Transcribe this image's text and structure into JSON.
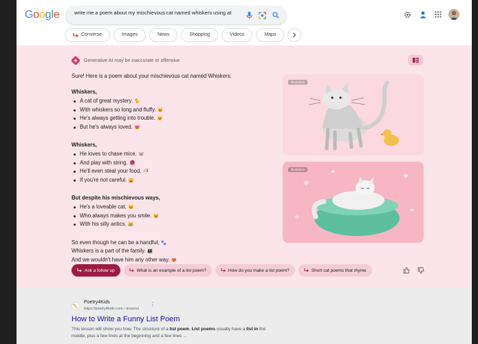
{
  "search": {
    "logo_letters": [
      {
        "char": "G",
        "color": "#4285f4"
      },
      {
        "char": "o",
        "color": "#ea4335"
      },
      {
        "char": "o",
        "color": "#fbbc05"
      },
      {
        "char": "g",
        "color": "#4285f4"
      },
      {
        "char": "l",
        "color": "#34a853"
      },
      {
        "char": "e",
        "color": "#ea4335"
      }
    ],
    "query": "write me a poem about my mischievous cat named whiskers using at least",
    "icons": [
      "mic-icon",
      "lens-icon",
      "search-icon"
    ]
  },
  "header_right": [
    "gear-icon",
    "labs-icon",
    "apps-grid-icon",
    "avatar"
  ],
  "tabs": [
    {
      "label": "Converse",
      "icon": "arrow-icon"
    },
    {
      "label": "Images"
    },
    {
      "label": "News"
    },
    {
      "label": "Shopping"
    },
    {
      "label": "Videos"
    },
    {
      "label": "Maps"
    }
  ],
  "ai": {
    "disclaimer": "Generative AI may be inaccurate or offensive",
    "intro": "Sure! Here is a poem about your mischievous cat named Whiskers:",
    "stanzas": [
      {
        "title": "Whiskers,",
        "lines": [
          {
            "text": "A cat of great mystery.",
            "emoji": "🐈"
          },
          {
            "text": "With whiskers so long and fluffy.",
            "emoji": "🐱"
          },
          {
            "text": "He's always getting into trouble.",
            "emoji": "🐱"
          },
          {
            "text": "But he's always loved.",
            "emoji": "😻"
          }
        ]
      },
      {
        "title": "Whiskers,",
        "lines": [
          {
            "text": "He loves to chase mice.",
            "emoji": "🐭"
          },
          {
            "text": "And play with string.",
            "emoji": "🧶"
          },
          {
            "text": "He'll even steal your food.",
            "emoji": "🍜"
          },
          {
            "text": "If you're not careful.",
            "emoji": "🙀"
          }
        ]
      },
      {
        "title": "But despite his mischievous ways,",
        "lines": [
          {
            "text": "He's a loveable cat.",
            "emoji": "🐱"
          },
          {
            "text": "Who always makes you smile.",
            "emoji": "😺"
          },
          {
            "text": "With his silly antics.",
            "emoji": "😹"
          }
        ]
      }
    ],
    "closing": [
      {
        "text": "So even though he can be a handful,",
        "emoji": "🐾"
      },
      {
        "text": "Whiskers is a part of the family.",
        "emoji": "👨‍👩‍👧"
      },
      {
        "text": "And we wouldn't have him any other way.",
        "emoji": "😻"
      }
    ],
    "image_tag": "Illustrative",
    "followups": [
      {
        "label": "Ask a follow up",
        "primary": true
      },
      {
        "label": "What is an example of a list poem?"
      },
      {
        "label": "How do you make a list poem?"
      },
      {
        "label": "Short cat poems that rhyme"
      }
    ]
  },
  "result": {
    "site": "Poetry4Kids",
    "url": "https://poetry4kids.com › lessons",
    "title": "How to Write a Funny List Poem",
    "snippet_parts": [
      {
        "t": "This lesson will show you how. The structure of a ",
        "b": false
      },
      {
        "t": "list poem",
        "b": true
      },
      {
        "t": ". ",
        "b": false
      },
      {
        "t": "List poems",
        "b": true
      },
      {
        "t": " usually have a ",
        "b": false
      },
      {
        "t": "list in",
        "b": true
      },
      {
        "t": " the middle, plus a few lines at the beginning and a few lines ...",
        "b": false
      }
    ]
  },
  "colors": {
    "ai_bg": "#fbe4ea",
    "primary_button": "#9b1b45",
    "link": "#1a0dab"
  }
}
